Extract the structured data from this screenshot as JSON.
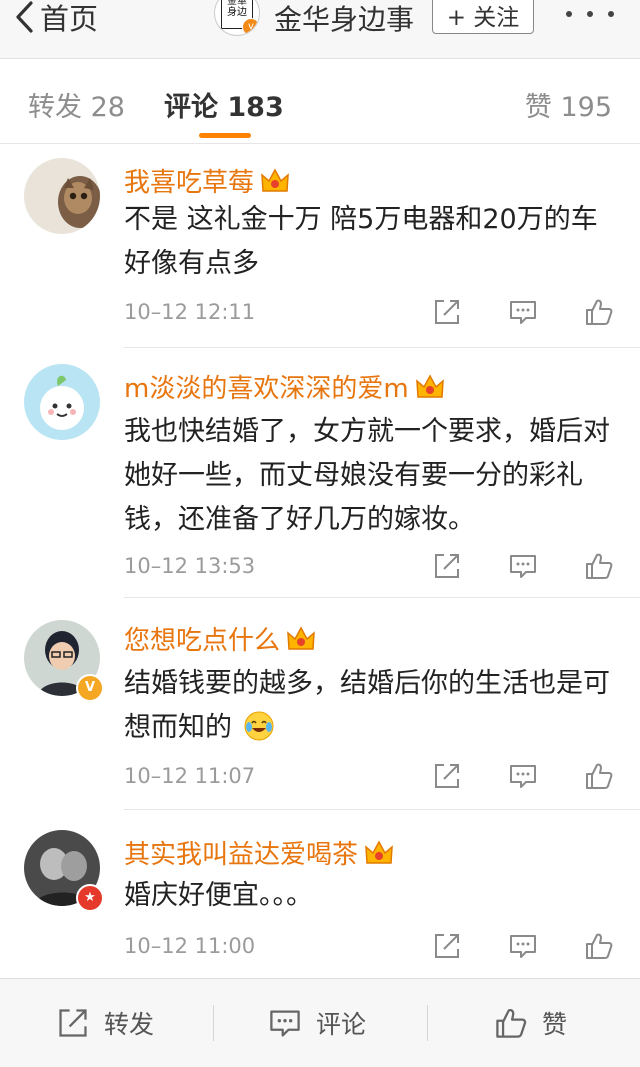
{
  "nav": {
    "back_label": "首页",
    "account_name": "金华身边事",
    "follow_label": "+ 关注",
    "seal_chars": "金华身边事"
  },
  "tabs": {
    "repost": "转发 28",
    "comment": "评论 183",
    "like": "赞 195",
    "active": "comment"
  },
  "comments": [
    {
      "username": "我喜吃草莓",
      "text": "不是 这礼金十万  陪5万电器和20万的车 好像有点多",
      "time": "10–12 12:11"
    },
    {
      "username": "m淡淡的喜欢深深的爱m",
      "text": "我也快结婚了，女方就一个要求，婚后对她好一些，而丈母娘没有要一分的彩礼钱，还准备了好几万的嫁妆。",
      "time": "10–12 13:53"
    },
    {
      "username": "您想吃点什么",
      "text": "结婚钱要的越多，结婚后你的生活也是可想而知的",
      "time": "10–12 11:07"
    },
    {
      "username": "其实我叫益达爱喝茶",
      "text": "婚庆好便宜。。。",
      "time": "10–12 11:00"
    }
  ],
  "bottom_bar": {
    "repost_label": "转发",
    "comment_label": "评论",
    "like_label": "赞"
  },
  "colors": {
    "accent": "#ff8200",
    "username": "#e8760f",
    "timestamp": "#9b9b9b"
  },
  "icons": [
    "chevron-left-icon",
    "more-icon",
    "member-crown-icon",
    "repost-icon",
    "comment-icon",
    "like-icon",
    "verified-badge-icon",
    "laugh-cry-emoji-icon"
  ]
}
